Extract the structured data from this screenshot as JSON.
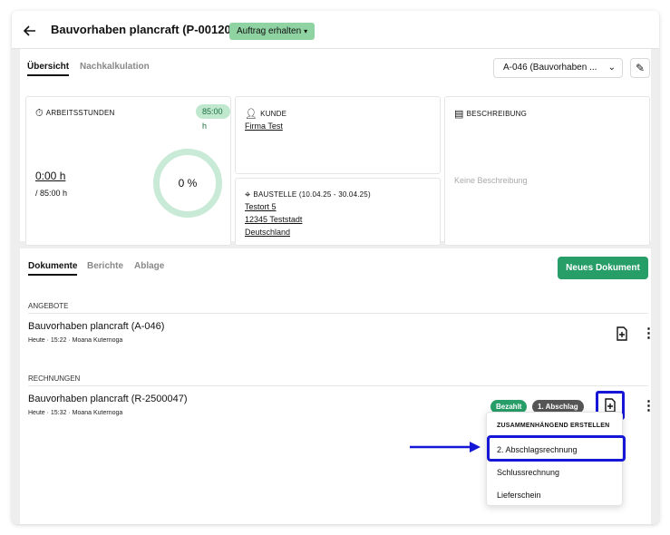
{
  "header": {
    "back_icon": "arrow-left-icon",
    "title": "Bauvorhaben plancraft (P-00120)",
    "status": "Auftrag erhalten",
    "status_color": "#8fd3a2"
  },
  "overview": {
    "tabs": [
      {
        "label": "Übersicht",
        "active": true
      },
      {
        "label": "Nachkalkulation",
        "active": false
      }
    ],
    "offer_select": "A-046 (Bauvorhaben ...",
    "edit_icon": "pencil-icon",
    "hours_card": {
      "icon": "stopwatch-icon",
      "heading": "ARBEITSSTUNDEN",
      "badge": "85:00 h",
      "worked": "0:00 h",
      "planned": "/ 85:00 h",
      "progress_text": "0 %",
      "progress": 0
    },
    "customer_card": {
      "icon": "user-icon",
      "heading": "KUNDE",
      "name": "Firma Test"
    },
    "site_card": {
      "icon": "location-pin-icon",
      "heading": "BAUSTELLE",
      "dates": "(10.04.25 - 30.04.25)",
      "street": "Testort 5",
      "city": "12345 Teststadt",
      "country": "Deutschland"
    },
    "description_card": {
      "icon": "message-icon",
      "heading": "BESCHREIBUNG",
      "placeholder": "Keine Beschreibung"
    }
  },
  "documents": {
    "tabs": [
      {
        "label": "Dokumente",
        "active": true
      },
      {
        "label": "Berichte",
        "active": false
      },
      {
        "label": "Ablage",
        "active": false
      }
    ],
    "new_button": "Neues Dokument",
    "new_button_color": "#279d68",
    "sections": [
      {
        "label": "ANGEBOTE",
        "items": [
          {
            "title": "Bauvorhaben plancraft (A-046)",
            "meta": "Heute · 15:22 · Moana Kuternoga"
          }
        ]
      },
      {
        "label": "RECHNUNGEN",
        "items": [
          {
            "title": "Bauvorhaben plancraft (R-2500047)",
            "meta": "Heute · 15:32 · Moana Kuternoga",
            "badges": [
              "Bezahlt",
              "1. Abschlag"
            ]
          }
        ]
      }
    ],
    "badge_colors": {
      "paid": "#279d68",
      "installment": "#555555"
    },
    "doc_action_icon": "file-plus-icon",
    "more_icon": "more-vertical-icon"
  },
  "menu": {
    "heading": "ZUSAMMENHÄNGEND ERSTELLEN",
    "items": [
      "2. Abschlagsrechnung",
      "Schlussrechnung",
      "Lieferschein"
    ],
    "highlight_color": "#1616d6"
  }
}
